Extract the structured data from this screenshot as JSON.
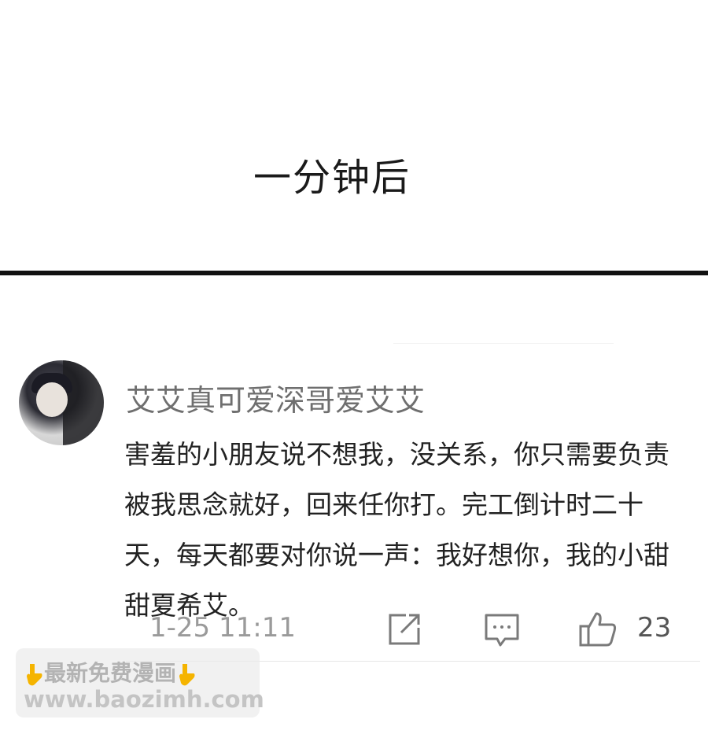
{
  "panel": {
    "caption": "一分钟后"
  },
  "comment": {
    "username": "艾艾真可爱深哥爱艾艾",
    "text": "害羞的小朋友说不想我，没关系，你只需要负责被我思念就好，回来任你打。完工倒计时二十天，每天都要对你说一声：我好想你，我的小甜甜夏希艾。",
    "timestamp": "1-25 11:11",
    "like_count": "23",
    "icons": [
      "share-icon",
      "reply-icon",
      "like-icon"
    ]
  },
  "watermark": {
    "line1": "最新免费漫画",
    "line2": "www.baozimh.com",
    "emoji_color": "#f5b400"
  }
}
